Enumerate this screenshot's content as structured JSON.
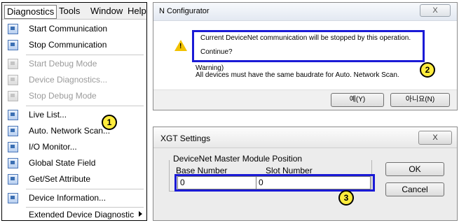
{
  "menubar": {
    "items": [
      "Diagnostics",
      "Tools",
      "Window",
      "Help"
    ]
  },
  "menu": {
    "items": [
      {
        "label": "Start Communication",
        "icon": "network-icon",
        "enabled": true
      },
      {
        "label": "Stop Communication",
        "icon": "network-icon",
        "enabled": true
      },
      {
        "label": "Start Debug Mode",
        "icon": "debug-icon",
        "enabled": false
      },
      {
        "label": "Device Diagnostics...",
        "icon": "diagnostics-icon",
        "enabled": false
      },
      {
        "label": "Stop Debug Mode",
        "icon": "debug-icon",
        "enabled": false
      },
      {
        "label": "Live List...",
        "icon": "list-icon",
        "enabled": true
      },
      {
        "label": "Auto. Network Scan...",
        "icon": "scan-icon",
        "enabled": true
      },
      {
        "label": "I/O Monitor...",
        "icon": "monitor-icon",
        "enabled": true
      },
      {
        "label": "Global State Field",
        "icon": "state-icon",
        "enabled": true
      },
      {
        "label": "Get/Set Attribute",
        "icon": "attribute-icon",
        "enabled": true
      },
      {
        "label": "Device Information...",
        "icon": "info-icon",
        "enabled": true
      },
      {
        "label": "Extended Device Diagnostic",
        "icon": "",
        "enabled": true
      }
    ]
  },
  "badges": [
    "1",
    "2",
    "3"
  ],
  "confirm_dialog": {
    "title": "N Configurator",
    "close": "X",
    "message": "Current DeviceNet communication will be stopped by this operation.",
    "continue": "Continue?",
    "warning_title": "Warning)",
    "warning_text": "All devices must have the same baudrate for Auto. Network Scan.",
    "yes": "예(Y)",
    "no": "아니요(N)"
  },
  "settings_dialog": {
    "title": "XGT Settings",
    "close": "X",
    "group_label": "DeviceNet Master Module Position",
    "base_label": "Base Number",
    "slot_label": "Slot Number",
    "base_value": "0",
    "slot_value": "0",
    "ok": "OK",
    "cancel": "Cancel"
  },
  "colors": {
    "highlight": "#1a1ad6",
    "badge": "#ffec3d"
  }
}
